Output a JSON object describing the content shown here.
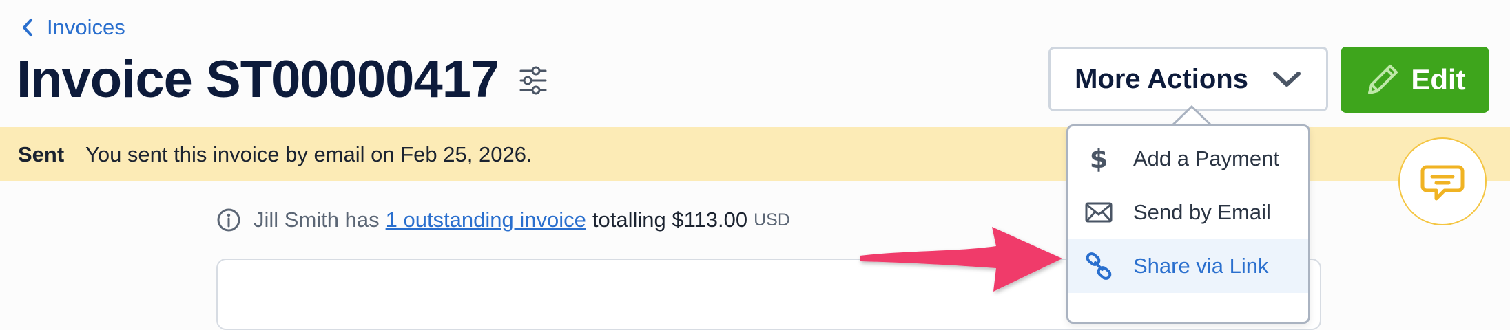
{
  "breadcrumb": {
    "label": "Invoices"
  },
  "page": {
    "title": "Invoice ST00000417"
  },
  "actions": {
    "more_actions_label": "More Actions",
    "edit_label": "Edit"
  },
  "banner": {
    "status": "Sent",
    "message": "You sent this invoice by email on Feb 25, 2026."
  },
  "info": {
    "prefix": "Jill Smith has",
    "link_text": "1 outstanding invoice",
    "middle": "totalling $113.00",
    "currency": "USD"
  },
  "dropdown": {
    "items": [
      {
        "label": "Add a Payment",
        "icon": "dollar-icon"
      },
      {
        "label": "Send by Email",
        "icon": "envelope-icon"
      },
      {
        "label": "Share via Link",
        "icon": "link-icon"
      }
    ]
  },
  "colors": {
    "accent": "#2a6fce",
    "edit_green": "#3ea51c",
    "banner_bg": "#fcebb6",
    "annotation_arrow": "#f03a6b"
  }
}
